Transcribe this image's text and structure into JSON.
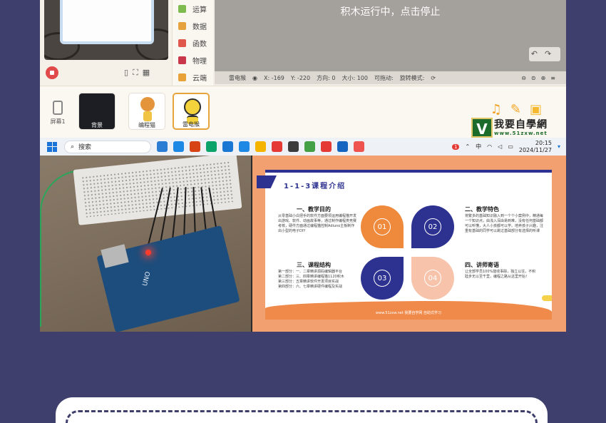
{
  "editor": {
    "categories": [
      {
        "icon": "calc-icon",
        "label": "运算",
        "color": "#7dbb4f"
      },
      {
        "icon": "data-icon",
        "label": "数据",
        "color": "#e6a23c"
      },
      {
        "icon": "function-icon",
        "label": "函数",
        "color": "#e0574b"
      },
      {
        "icon": "magnet-icon",
        "label": "物理",
        "color": "#c9384a"
      },
      {
        "icon": "cloud-icon",
        "label": "云端",
        "color": "#e8a23a"
      }
    ],
    "run_message": "积木运行中，点击停止",
    "status": {
      "sprite": "雷电猴",
      "x_label": "X:",
      "x_value": "-169",
      "y_label": "Y:",
      "y_value": "-220",
      "direction_label": "方向:",
      "direction_value": "0",
      "size_label": "大小:",
      "size_value": "100",
      "draggable_label": "可拖动:",
      "rotation_label": "旋转模式:"
    },
    "screen_label": "屏幕1",
    "sprites": [
      {
        "label": "背景"
      },
      {
        "label": "编程猫"
      },
      {
        "label": "雷电猴"
      }
    ]
  },
  "watermark": {
    "glyph": "V",
    "name": "我要自學網",
    "url": "www.51zxw.net"
  },
  "taskbar": {
    "search_placeholder": "搜索",
    "ime": "中",
    "time": "20:15",
    "date": "2024/11/27",
    "notification_count": "1",
    "apps": [
      "#2b7cd3",
      "#1e88e5",
      "#d84315",
      "#0aa36a",
      "#1976d2",
      "#1e88e5",
      "#f4b400",
      "#e53935",
      "#3c3c3c",
      "#43a047",
      "#e53935",
      "#1565c0",
      "#ef5350"
    ]
  },
  "slide": {
    "title": "1-1-3课程介绍",
    "sections": [
      {
        "heading": "一、教学目的",
        "body": "从零基础小白把手的软件方面要领运用编程猫开发出游戏、软件、动画故事等，通过制作编程类竞赛考核，硬件方面通过编程猫控制Adiuno主板制作出小型的电子DIY"
      },
      {
        "heading": "二、教学特色",
        "body": "将繁多的基础知识融入到一个个小案例中，精通每一个知识点，由浅入深由易到难，没有任何基础都可以听懂，大人小孩都可以学。培养孩子兴趣，注重有基础的同学可以跳过基础部分有选择的听课"
      },
      {
        "heading": "三、课程结构",
        "body": "第一部分：一、二章精讲源码编辑器平台\n第二部分：三、四章精讲编程猫1120积木\n第三部分：五章精讲软件开发项目实战\n第四部分：六、七章精讲硬件编程及实战"
      },
      {
        "heading": "四、讲师寄语",
        "body": "让全部学员100%能收事踪，独立以往，不积跬步无以至千里，编程之路从这里开始！"
      }
    ],
    "petals": [
      "01",
      "02",
      "03",
      "04"
    ],
    "footer": "www.51zxw.net  我要自学网  自助式学习"
  }
}
